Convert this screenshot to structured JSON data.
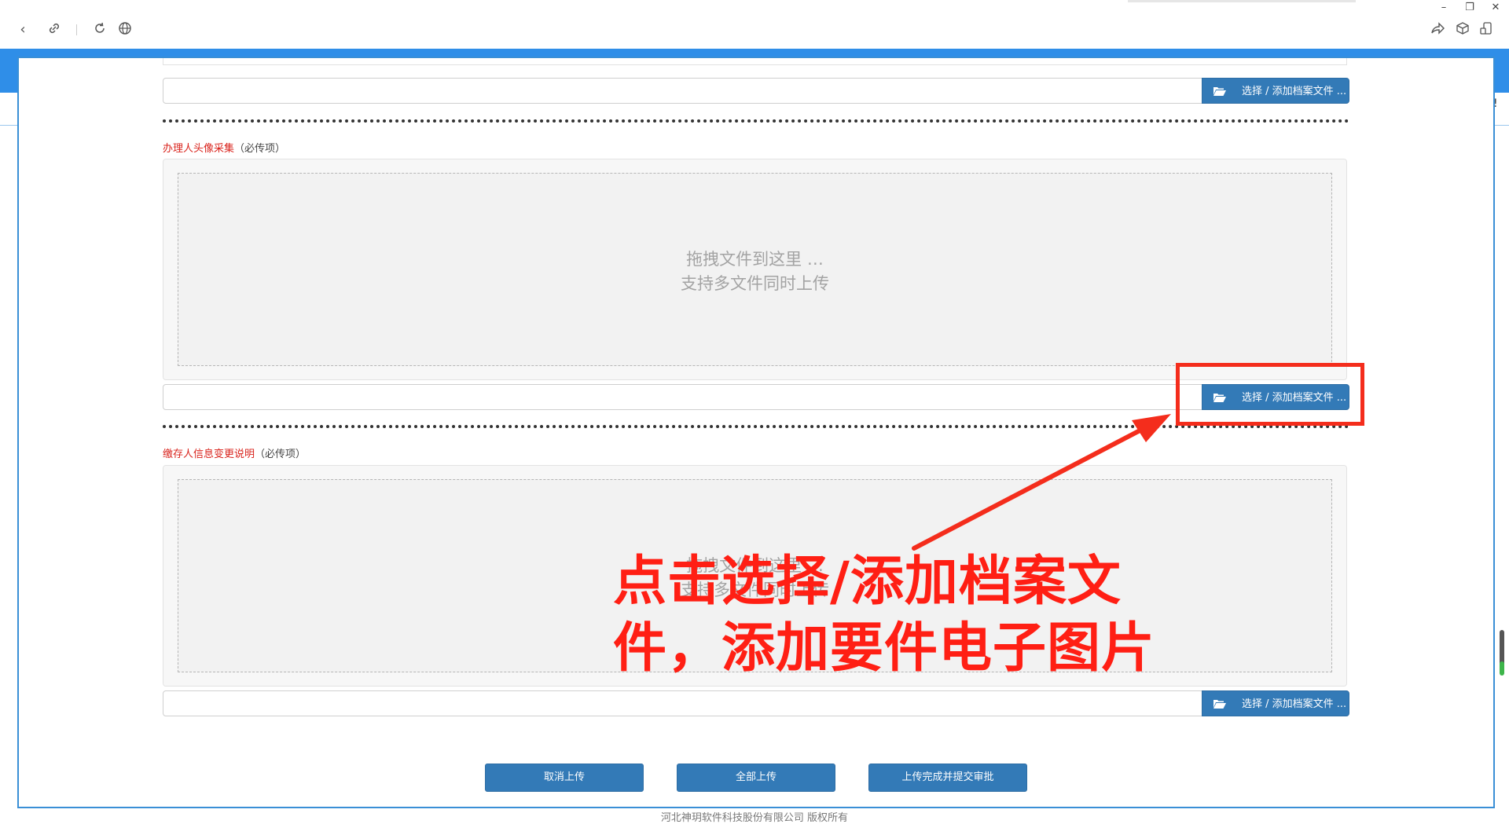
{
  "sections": [
    {
      "title": "办理人头像采集",
      "note": "（必传项）",
      "drop_hint_1": "拖拽文件到这里 …",
      "drop_hint_2": "支持多文件同时上传"
    },
    {
      "title": "缴存人信息变更说明",
      "note": "（必传项）",
      "drop_hint_1": "拖拽文件到这里 …",
      "drop_hint_2": "支持多文件同时上传"
    }
  ],
  "choose_button_label": "选择 / 添加档案文件 ...",
  "bottom_buttons": {
    "cancel": "取消上传",
    "upload_all": "全部上传",
    "submit": "上传完成并提交审批"
  },
  "footer": "河北神玥软件科技股份有限公司 版权所有",
  "annotation": {
    "line1": "点击选择/添加档案文",
    "line2": "件，添加要件电子图片",
    "color": "#ff1f14"
  },
  "colors": {
    "primary_button": "#337ab7",
    "required_label": "#d9231c",
    "header_band": "#2f8ee8"
  },
  "icons": [
    "back-icon",
    "link-icon",
    "refresh-icon",
    "globe-icon",
    "share-icon",
    "cube-icon",
    "phone-icon",
    "folder-open-icon"
  ]
}
